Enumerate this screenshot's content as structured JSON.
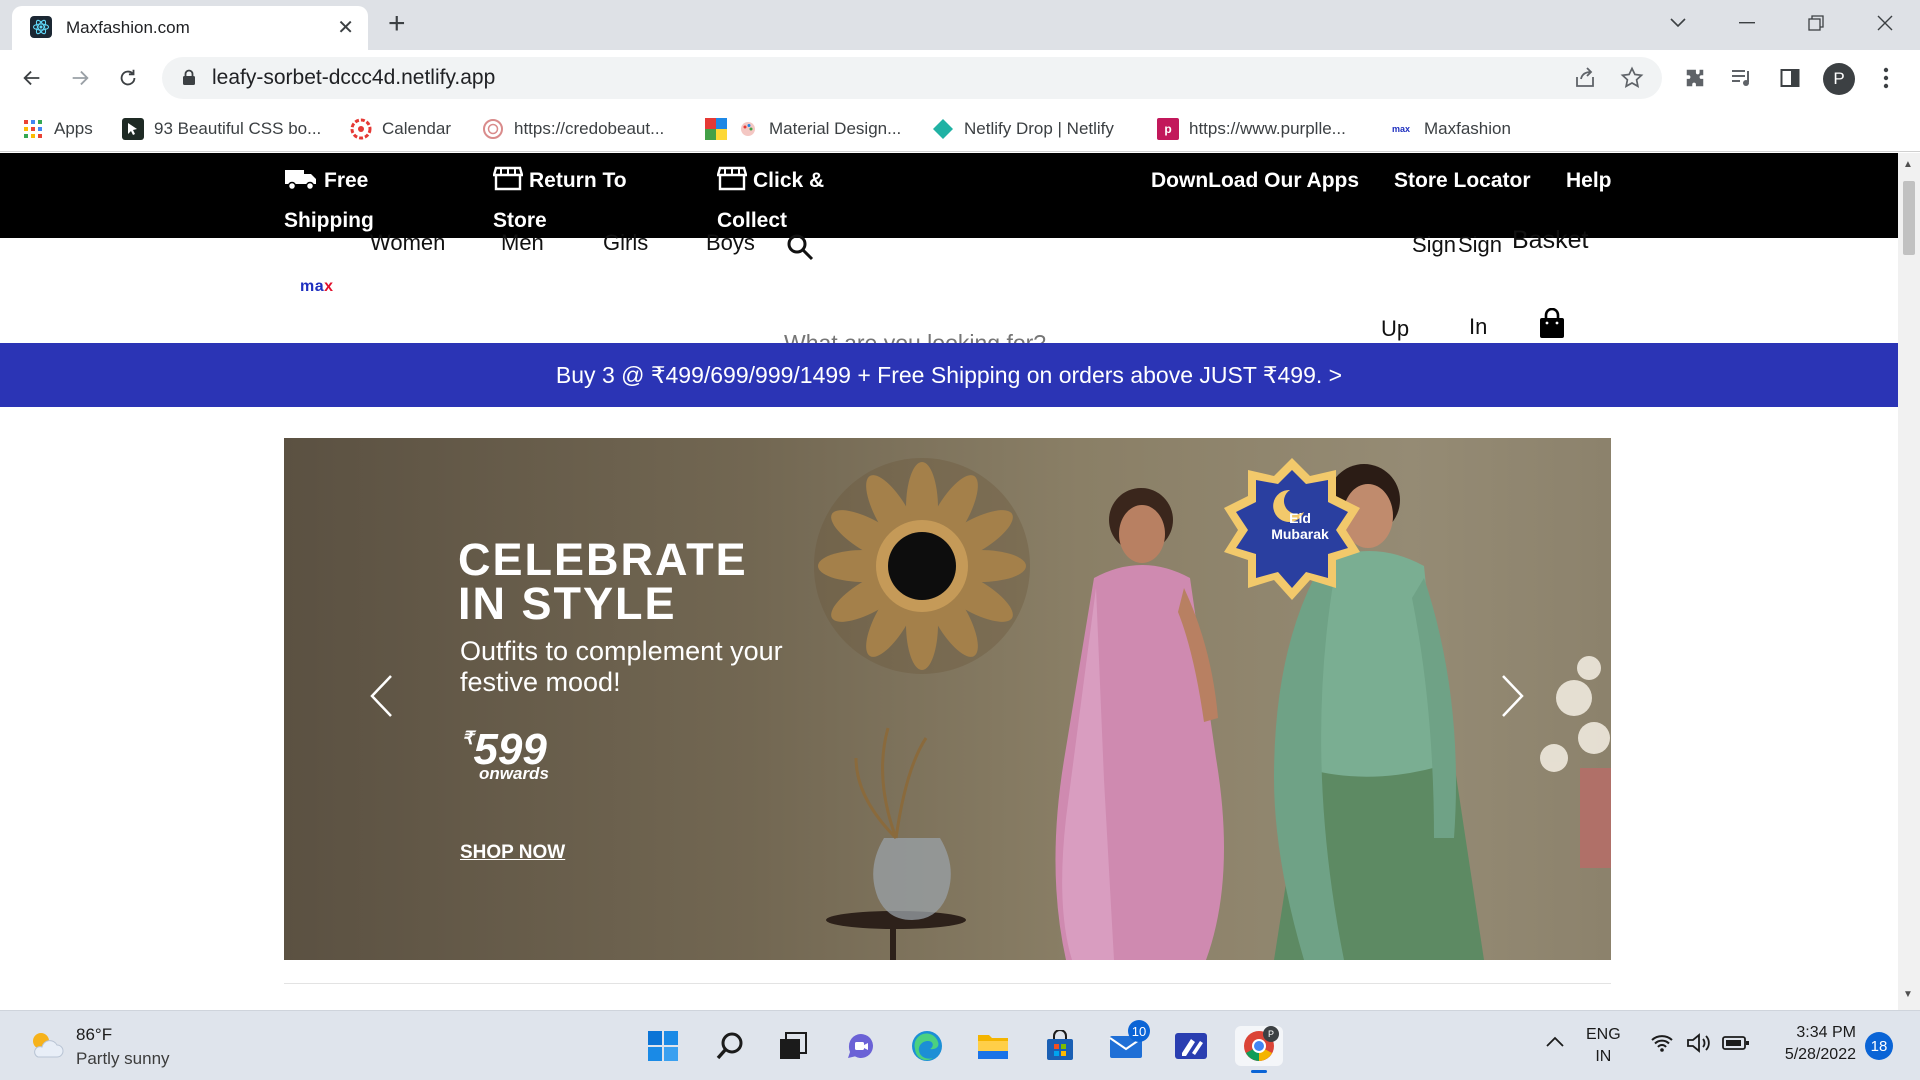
{
  "browser": {
    "tab_title": "Maxfashion.com",
    "url": "leafy-sorbet-dccc4d.netlify.app",
    "profile_initial": "P",
    "bookmarks": [
      {
        "label": "Apps"
      },
      {
        "label": "93 Beautiful CSS bo..."
      },
      {
        "label": "Calendar"
      },
      {
        "label": "https://credobeaut..."
      },
      {
        "label": "Material Design..."
      },
      {
        "label": "Netlify Drop | Netlify"
      },
      {
        "label": "https://www.purplle..."
      },
      {
        "label": "Maxfashion",
        "icon_text": "max"
      }
    ]
  },
  "site": {
    "topbar": {
      "free_shipping": [
        "Free",
        "Shipping"
      ],
      "return_to_store": [
        "Return To",
        "Store"
      ],
      "click_collect": [
        "Click &",
        "Collect"
      ],
      "download_apps": "DownLoad Our Apps",
      "store_locator": "Store Locator",
      "help": "Help"
    },
    "nav": {
      "women": "Women",
      "men": "Men",
      "girls": "Girls",
      "boys": "Boys",
      "logo": "ma",
      "logo_x": "x",
      "search_placeholder": "What are you looking for?",
      "sign_up": [
        "Sign",
        "Up"
      ],
      "sign_in": [
        "Sign",
        "In"
      ],
      "basket": "Basket"
    },
    "promo": "Buy 3 @ ₹499/699/999/1499 + Free Shipping on orders above JUST ₹499. >",
    "hero": {
      "title_line1": "CELEBRATE",
      "title_line2": "IN STYLE",
      "subtitle": "Outfits to complement your festive mood!",
      "currency": "₹",
      "price": "599",
      "onwards": "onwards",
      "cta": "SHOP NOW",
      "badge_line1": "Eid",
      "badge_line2": "Mubarak"
    }
  },
  "taskbar": {
    "temperature": "86°F",
    "weather": "Partly sunny",
    "mail_badge": "10",
    "language": "ENG",
    "region": "IN",
    "time": "3:34 PM",
    "date": "5/28/2022",
    "notifications": "18"
  }
}
